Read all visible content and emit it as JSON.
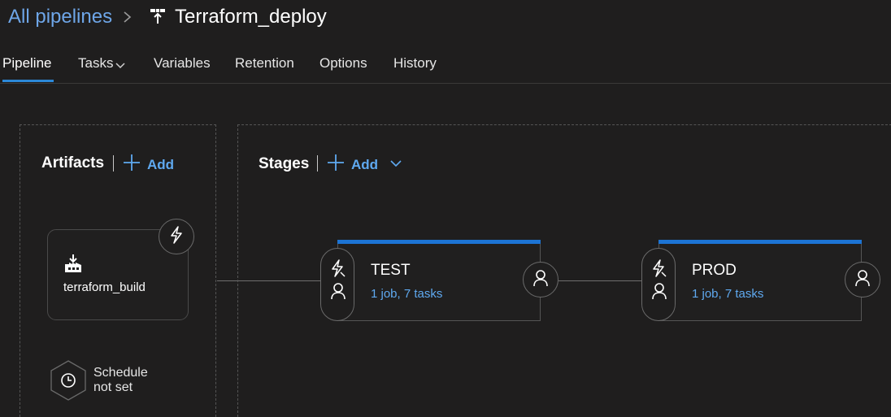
{
  "breadcrumb": {
    "root": "All pipelines",
    "separator": ">",
    "title": "Terraform_deploy"
  },
  "tabs": [
    {
      "label": "Pipeline",
      "active": true
    },
    {
      "label": "Tasks",
      "dropdown": true
    },
    {
      "label": "Variables"
    },
    {
      "label": "Retention"
    },
    {
      "label": "Options"
    },
    {
      "label": "History"
    }
  ],
  "artifacts": {
    "title": "Artifacts",
    "add_label": "Add",
    "items": [
      {
        "name": "terraform_build",
        "icon": "build-artifact-icon",
        "trigger_icon": "lightning-icon"
      }
    ],
    "schedule": {
      "line1": "Schedule",
      "line2": "not set",
      "icon": "clock-icon"
    }
  },
  "stages": {
    "title": "Stages",
    "add_label": "Add",
    "items": [
      {
        "name": "TEST",
        "meta": "1 job, 7 tasks"
      },
      {
        "name": "PROD",
        "meta": "1 job, 7 tasks"
      }
    ]
  },
  "colors": {
    "background": "#1f1e1e",
    "accent": "#2b88d8",
    "stage_bar": "#1c74d4",
    "link": "#5fa9f0"
  }
}
